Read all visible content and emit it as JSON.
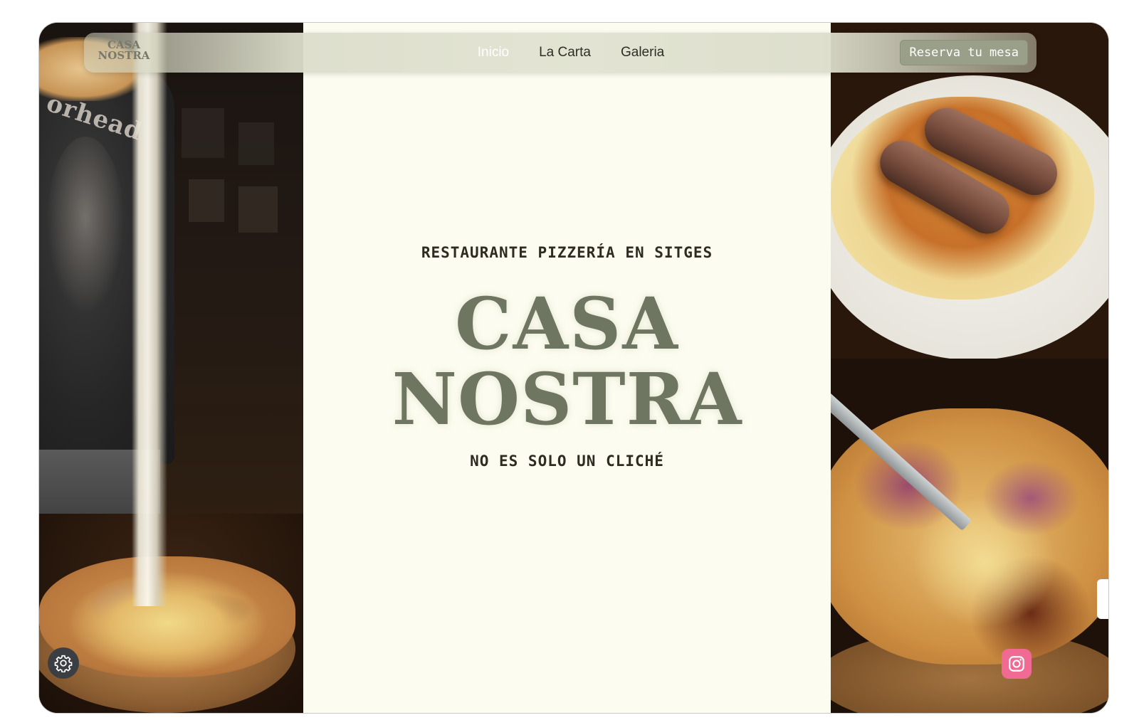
{
  "nav": {
    "logo_line1": "CASA",
    "logo_line2": "NOSTRA",
    "links": [
      "Inicio",
      "La Carta",
      "Galeria"
    ],
    "active_link": "Inicio",
    "reserve_label": "Reserva tu mesa"
  },
  "hero": {
    "tagline": "RESTAURANTE PIZZERÍA EN SITGES",
    "title_line1": "CASA",
    "title_line2": "NOSTRA",
    "subtitle": "NO ES SOLO UN CLICHÉ"
  },
  "left_photo": {
    "shirt_text": "orhead"
  },
  "icons": {
    "settings": "gear-icon",
    "instagram": "instagram-icon"
  },
  "colors": {
    "accent": "#6e7561",
    "background": "#fcfcf0",
    "button": "#9a9f89",
    "instagram": "#f06a93"
  }
}
